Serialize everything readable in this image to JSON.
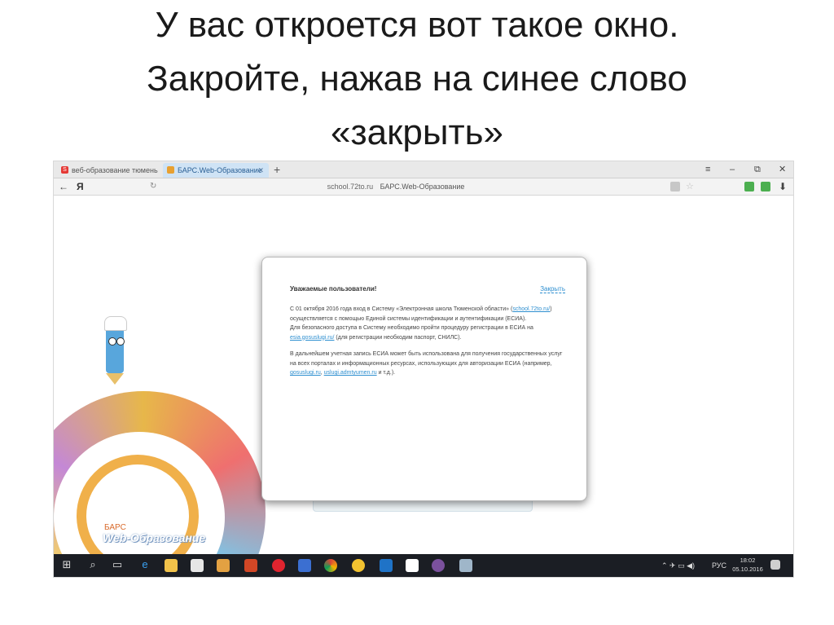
{
  "slide": {
    "title_lines": [
      "У вас откроется вот такое окно.",
      "Закройте, нажав на синее слово",
      "«закрыть»"
    ]
  },
  "browser": {
    "tabs": [
      {
        "label": "веб-образование тюмень",
        "icon": "yandex-search-icon"
      },
      {
        "label": "БАРС.Web-Образование",
        "icon": "bars-favicon",
        "active": true
      }
    ],
    "new_tab": "+",
    "window_controls": {
      "menu": "≡",
      "minimize": "–",
      "restore": "⧉",
      "close": "✕"
    },
    "back": "←",
    "logo": "Я",
    "reload": "↻",
    "url_host": "school.72to.ru",
    "url_title": "БАРС.Web-Образование",
    "download": "⬇"
  },
  "dialog": {
    "title": "Уважаемые пользователи!",
    "close_label": "Закрыть",
    "p1_before": "С 01 октября 2016 года вход в Систему «Электронная школа Тюменской области» (",
    "p1_link": "school.72to.ru/",
    "p1_after": ") осуществляется с помощью Единой системы идентификации и аутентификации (ЕСИА).",
    "p2_before": "Для безопасного доступа в Систему необходимо пройти процедуру регистрации в ЕСИА на ",
    "p2_link": "esia.gosuslugi.ru/",
    "p2_after": " (для регистрации необходим паспорт, СНИЛС).",
    "p3_before": "В дальнейшем учетная запись ЕСИА может быть использована для получения государственных услуг на всех порталах и информационных ресурсах, использующих для авторизации ЕСИА (например, ",
    "p3_link1": "gosuslugi.ru",
    "p3_sep": ", ",
    "p3_link2": "uslugi.admtyumen.ru",
    "p3_after": " и т.д.)."
  },
  "page_logo": {
    "small": "БАРС",
    "big": "Web-Образование"
  },
  "taskbar": {
    "icons": [
      "windows-start-icon",
      "search-icon",
      "task-view-icon",
      "edge-icon",
      "file-explorer-icon",
      "store-icon",
      "media-icon",
      "powerpoint-icon",
      "opera-icon",
      "app-icon",
      "chrome-icon",
      "yandex-browser-icon",
      "outlook-icon",
      "yandex-icon",
      "viber-icon",
      "paint-icon"
    ],
    "lang": "РУС",
    "time": "18:02",
    "date": "05.10.2016"
  }
}
